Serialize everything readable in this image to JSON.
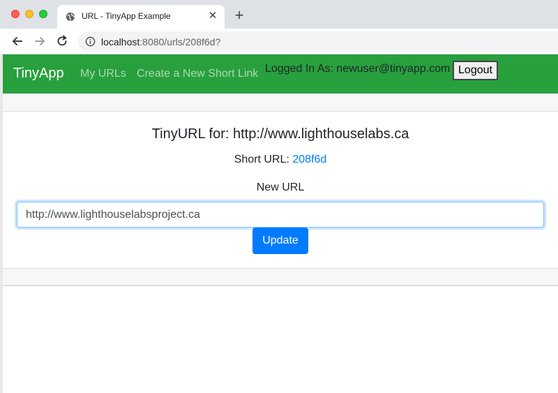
{
  "browser": {
    "tab_title": "URL - TinyApp Example",
    "tab_close": "✕",
    "new_tab": "+",
    "url_host": "localhost",
    "url_rest": ":8080/urls/208f6d?",
    "icons": [
      "globe-icon",
      "back-arrow-icon",
      "forward-arrow-icon",
      "reload-icon",
      "info-icon"
    ]
  },
  "navbar": {
    "brand": "TinyApp",
    "links": [
      "My URLs",
      "Create a New Short Link"
    ],
    "logged_in_text": "Logged In As: newuser@tinyapp.com",
    "logout_label": "Logout",
    "bg_color": "#28a03e"
  },
  "main": {
    "title": "TinyURL for: http://www.lighthouselabs.ca",
    "short_url_label": "Short URL:",
    "short_url_value": "208f6d",
    "new_url_label": "New URL",
    "new_url_value": "http://www.lighthouselabsproject.ca",
    "update_label": "Update",
    "link_color": "#007bff"
  }
}
